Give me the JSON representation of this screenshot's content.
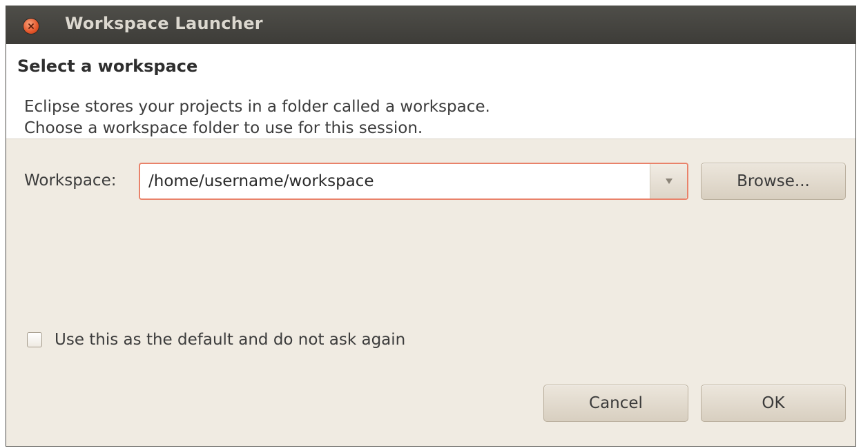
{
  "window": {
    "title": "Workspace Launcher"
  },
  "header": {
    "title": "Select a workspace",
    "description_line1": "Eclipse stores your projects in a folder called a workspace.",
    "description_line2": "Choose a workspace folder to use for this session."
  },
  "workspace": {
    "label": "Workspace:",
    "value": "/home/username/workspace",
    "dropdown_icon": "chevron-down-icon",
    "browse_label": "Browse..."
  },
  "default_checkbox": {
    "label": "Use this as the default and do not ask again",
    "checked": false
  },
  "buttons": {
    "cancel_label": "Cancel",
    "ok_label": "OK"
  },
  "colors": {
    "titlebar": "#3d3c38",
    "dialog_bg": "#f0ebe2",
    "focus_border": "#e9826a",
    "close_button": "#e5562a"
  }
}
